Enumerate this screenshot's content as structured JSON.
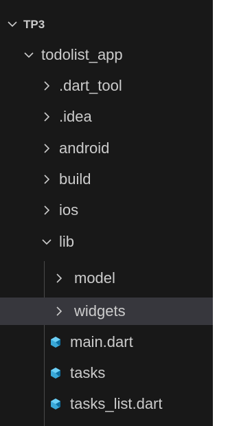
{
  "explorer": {
    "root": {
      "label": "TP3",
      "expanded": true,
      "icon": "chevron-down-icon"
    },
    "project": {
      "label": "todolist_app",
      "expanded": true,
      "icon": "chevron-down-icon"
    },
    "folders": [
      {
        "label": ".dart_tool",
        "expanded": false,
        "icon": "chevron-right-icon"
      },
      {
        "label": ".idea",
        "expanded": false,
        "icon": "chevron-right-icon"
      },
      {
        "label": "android",
        "expanded": false,
        "icon": "chevron-right-icon"
      },
      {
        "label": "build",
        "expanded": false,
        "icon": "chevron-right-icon"
      },
      {
        "label": "ios",
        "expanded": false,
        "icon": "chevron-right-icon"
      },
      {
        "label": "lib",
        "expanded": true,
        "icon": "chevron-down-icon"
      }
    ],
    "lib_children": [
      {
        "label": "model",
        "type": "folder",
        "expanded": false,
        "icon": "chevron-right-icon"
      },
      {
        "label": "widgets",
        "type": "folder",
        "expanded": false,
        "selected": true,
        "icon": "chevron-right-icon"
      },
      {
        "label": "main.dart",
        "type": "file",
        "icon": "dart-file-icon"
      },
      {
        "label": "tasks",
        "type": "file",
        "icon": "dart-file-icon"
      },
      {
        "label": "tasks_list.dart",
        "type": "file",
        "icon": "dart-file-icon"
      }
    ]
  },
  "colors": {
    "background": "#181818",
    "text": "#cccccc",
    "selected_row": "#37373d",
    "dart_icon": "#3aa8d8",
    "indent_guide": "#4a4a4a"
  }
}
